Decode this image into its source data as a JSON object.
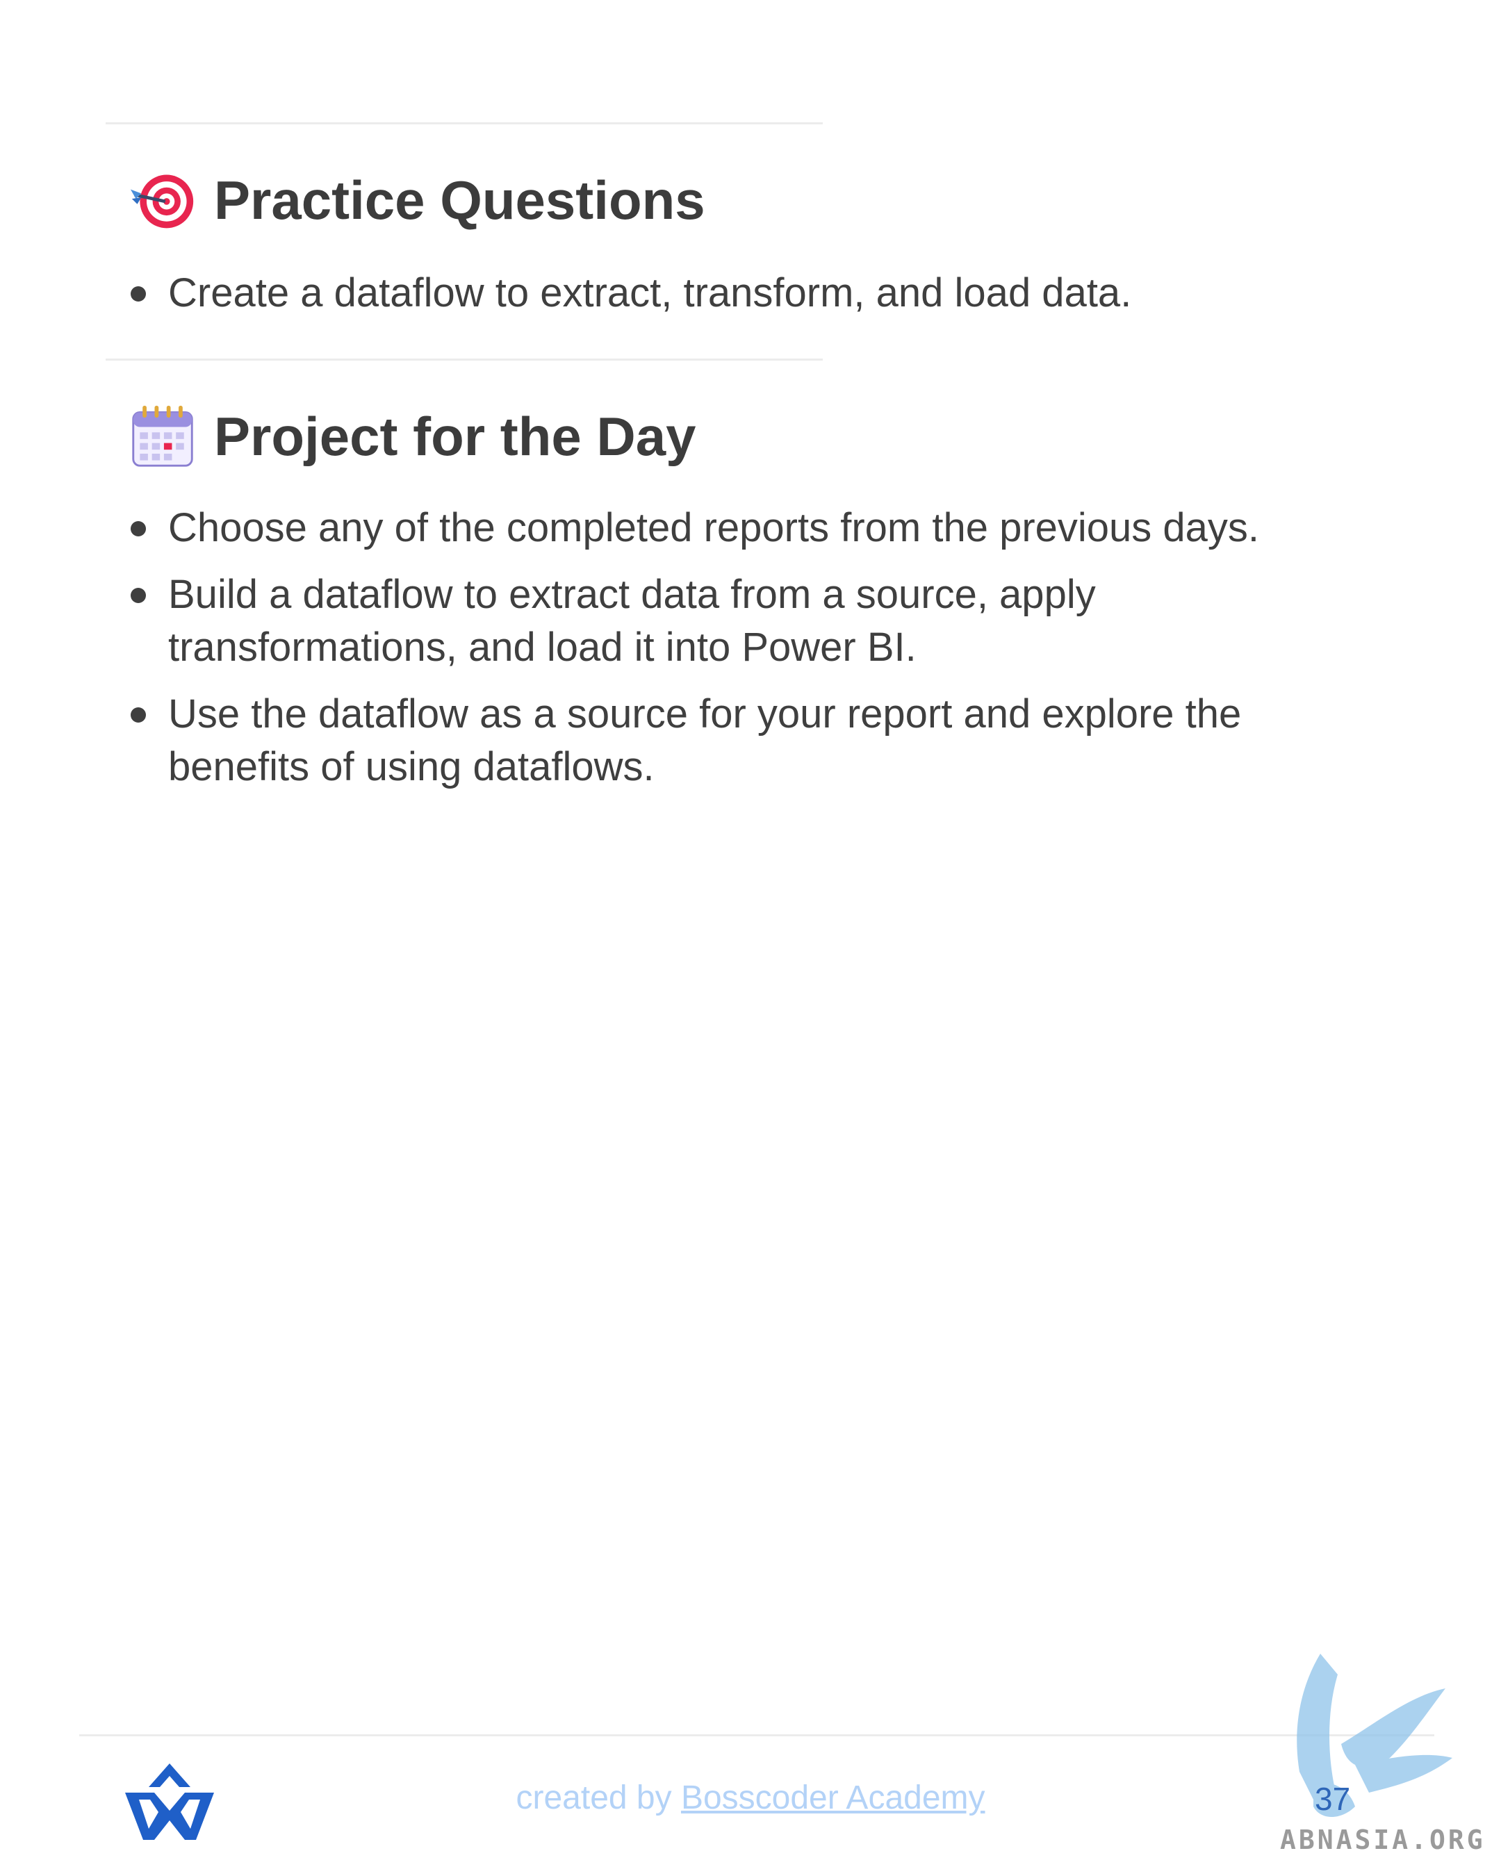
{
  "sections": [
    {
      "icon": "target-icon",
      "title": "Practice Questions",
      "items": [
        "Create a dataflow to extract, transform, and load data."
      ]
    },
    {
      "icon": "calendar-icon",
      "title": "Project for the Day",
      "items": [
        "Choose any of the completed reports from the previous days.",
        "Build a dataflow to extract data from a source, apply transformations, and load it into Power BI.",
        "Use the dataflow as a source for your report and explore the benefits of using dataflows."
      ]
    }
  ],
  "footer": {
    "prefix": "created by ",
    "link_text": "Bosscoder Academy",
    "page_number": "37",
    "watermark": "ABNASIA.ORG"
  },
  "colors": {
    "text": "#3f3f3f",
    "footer_link": "#b3d2f7",
    "logo_blue": "#1f5fc8",
    "rule": "#ececec"
  }
}
